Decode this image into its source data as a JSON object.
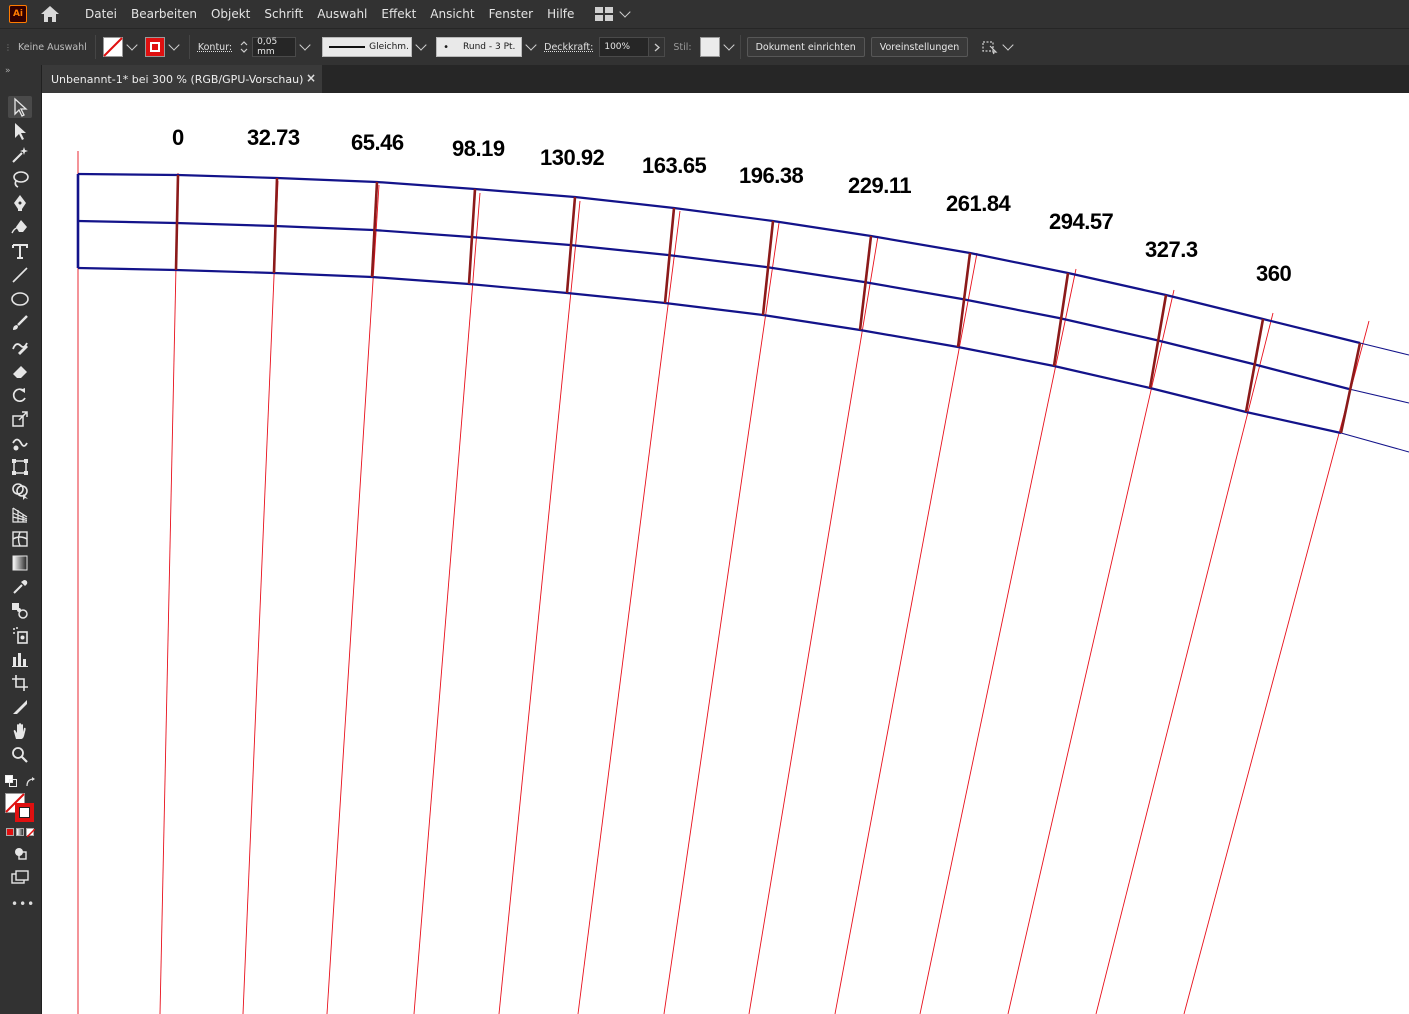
{
  "app": {
    "logo": "Ai",
    "menu": [
      "Datei",
      "Bearbeiten",
      "Objekt",
      "Schrift",
      "Auswahl",
      "Effekt",
      "Ansicht",
      "Fenster",
      "Hilfe"
    ]
  },
  "control": {
    "selection": "Keine Auswahl",
    "stroke_label": "Kontur:",
    "stroke_weight": "0,05 mm",
    "profile": "Gleichm.",
    "brush": "Rund - 3 Pt.",
    "opacity_label": "Deckkraft:",
    "opacity": "100%",
    "style_label": "Stil:",
    "doc_setup": "Dokument einrichten",
    "prefs": "Voreinstellungen"
  },
  "tab": {
    "title": "Unbenannt-1* bei 300 % (RGB/GPU-Vorschau)",
    "close": "×"
  },
  "tools": [
    "selection-tool",
    "direct-selection-tool",
    "magic-wand-tool",
    "lasso-tool",
    "pen-tool",
    "curvature-tool",
    "type-tool",
    "line-tool",
    "ellipse-tool",
    "paintbrush-tool",
    "shaper-tool",
    "eraser-tool",
    "rotate-tool",
    "scale-tool",
    "warp-tool",
    "free-transform-tool",
    "shape-builder-tool",
    "perspective-grid-tool",
    "mesh-tool",
    "gradient-tool",
    "eyedropper-tool",
    "blend-tool",
    "symbol-sprayer-tool",
    "column-graph-tool",
    "artboard-tool",
    "slice-tool",
    "hand-tool",
    "zoom-tool"
  ],
  "labels": [
    "0",
    "32.73",
    "65.46",
    "98.19",
    "130.92",
    "163.65",
    "196.38",
    "229.11",
    "261.84",
    "294.57",
    "327.3",
    "360"
  ],
  "colors": {
    "guide": "#e8101c",
    "arc": "#13138a",
    "tick": "#8b1a1a",
    "fill_swatch": "#ffffff",
    "stroke_swatch": "#e01010"
  }
}
